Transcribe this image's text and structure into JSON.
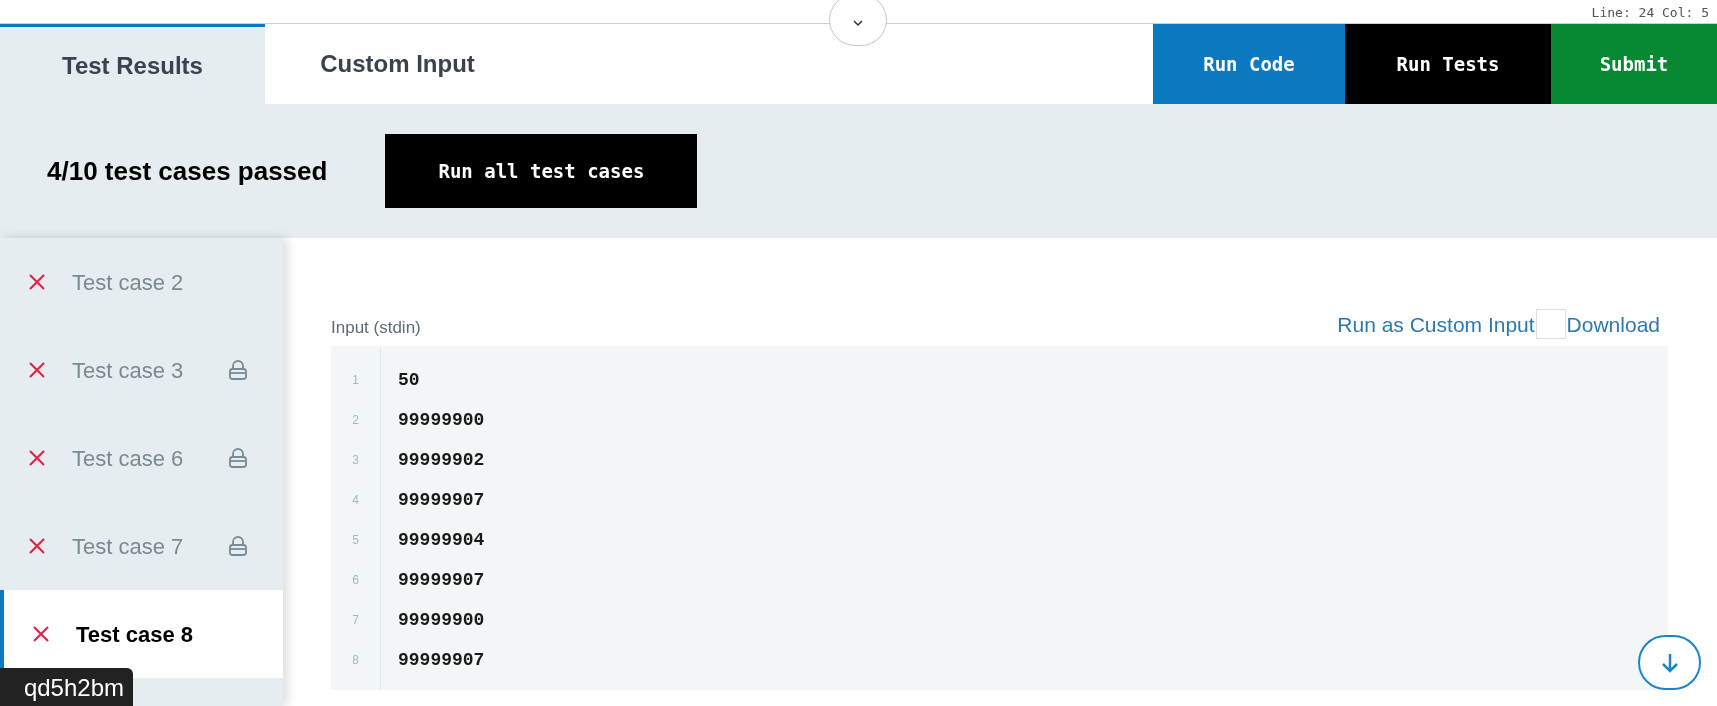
{
  "editor_status": "Line: 24 Col: 5",
  "tabs": [
    {
      "label": "Test Results",
      "selected": true
    },
    {
      "label": "Custom Input",
      "selected": false
    }
  ],
  "actions": [
    {
      "label": "Run Code",
      "kind": "primary"
    },
    {
      "label": "Run Tests",
      "kind": "dark"
    },
    {
      "label": "Submit",
      "kind": "success"
    }
  ],
  "summary": {
    "text": "4/10 test cases passed",
    "button": "Run all test cases"
  },
  "test_cases": [
    {
      "label": "Test case 2",
      "passed": false,
      "locked": false,
      "selected": false
    },
    {
      "label": "Test case 3",
      "passed": false,
      "locked": true,
      "selected": false
    },
    {
      "label": "Test case 6",
      "passed": false,
      "locked": true,
      "selected": false
    },
    {
      "label": "Test case 7",
      "passed": false,
      "locked": true,
      "selected": false
    },
    {
      "label": "Test case 8",
      "passed": false,
      "locked": false,
      "selected": true
    }
  ],
  "input_panel": {
    "label": "Input (stdin)",
    "links": [
      "Run as Custom Input",
      "Download"
    ],
    "lines": [
      {
        "number": "1",
        "text": "50"
      },
      {
        "number": "2",
        "text": "99999900"
      },
      {
        "number": "3",
        "text": "99999902"
      },
      {
        "number": "4",
        "text": "99999907"
      },
      {
        "number": "5",
        "text": "99999904"
      },
      {
        "number": "6",
        "text": "99999907"
      },
      {
        "number": "7",
        "text": "99999900"
      },
      {
        "number": "8",
        "text": "99999907"
      }
    ]
  },
  "tooltip": "qd5h2bm"
}
